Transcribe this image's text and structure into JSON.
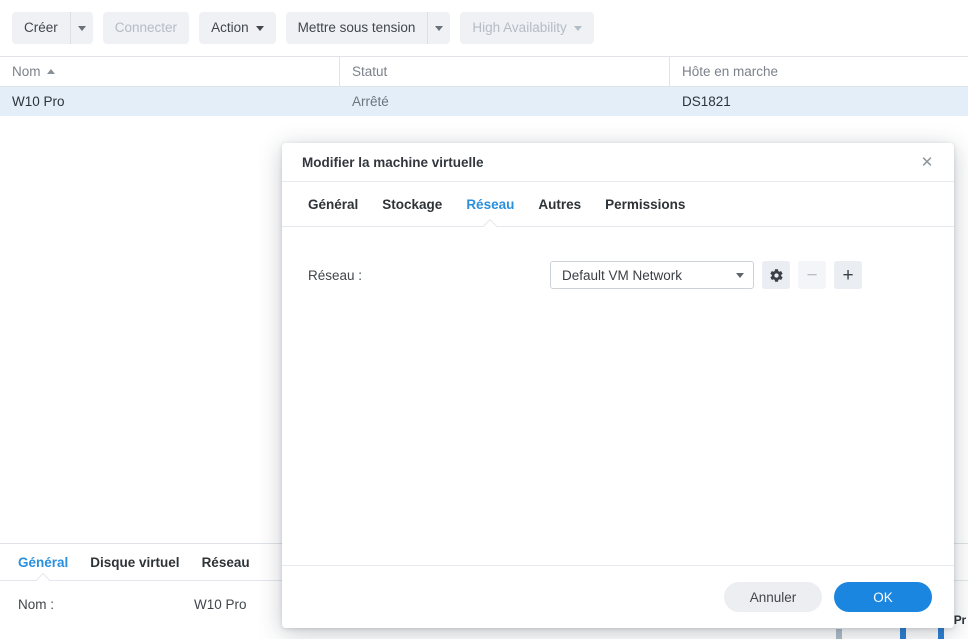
{
  "toolbar": {
    "buttons": [
      {
        "label": "Créer",
        "has_caret": true,
        "split": true,
        "disabled": false
      },
      {
        "label": "Connecter",
        "has_caret": false,
        "split": false,
        "disabled": true
      },
      {
        "label": "Action",
        "has_caret": true,
        "split": false,
        "disabled": false
      },
      {
        "label": "Mettre sous tension",
        "has_caret": true,
        "split": true,
        "disabled": false
      },
      {
        "label": "High Availability",
        "has_caret": true,
        "split": false,
        "disabled": true
      }
    ]
  },
  "table": {
    "columns": [
      "Nom",
      "Statut",
      "Hôte en marche"
    ],
    "sort_column": "Nom",
    "sort_direction": "asc",
    "rows": [
      {
        "name": "W10 Pro",
        "status": "Arrêté",
        "host": "DS1821",
        "selected": true
      }
    ]
  },
  "detail_panel": {
    "tabs": [
      {
        "label": "Général",
        "active": true
      },
      {
        "label": "Disque virtuel",
        "active": false
      },
      {
        "label": "Réseau",
        "active": false
      }
    ],
    "fields": [
      {
        "label": "Nom :",
        "value": "W10 Pro"
      }
    ]
  },
  "background_widget": {
    "label": "Pr"
  },
  "modal": {
    "title": "Modifier la machine virtuelle",
    "close_label": "✕",
    "tabs": [
      {
        "label": "Général",
        "active": false
      },
      {
        "label": "Stockage",
        "active": false
      },
      {
        "label": "Réseau",
        "active": true
      },
      {
        "label": "Autres",
        "active": false
      },
      {
        "label": "Permissions",
        "active": false
      }
    ],
    "network_field": {
      "label": "Réseau :",
      "selected_option": "Default VM Network",
      "options": [
        "Default VM Network"
      ],
      "settings_icon": "gear-icon",
      "remove_icon": "minus-icon",
      "add_icon": "plus-icon",
      "remove_disabled": true
    },
    "footer": {
      "cancel_label": "Annuler",
      "ok_label": "OK"
    }
  },
  "colors": {
    "accent_blue": "#2a8fdd",
    "primary_button": "#1a86e0",
    "selected_row": "#e3eef9",
    "toolbar_button": "#eff1f5"
  }
}
